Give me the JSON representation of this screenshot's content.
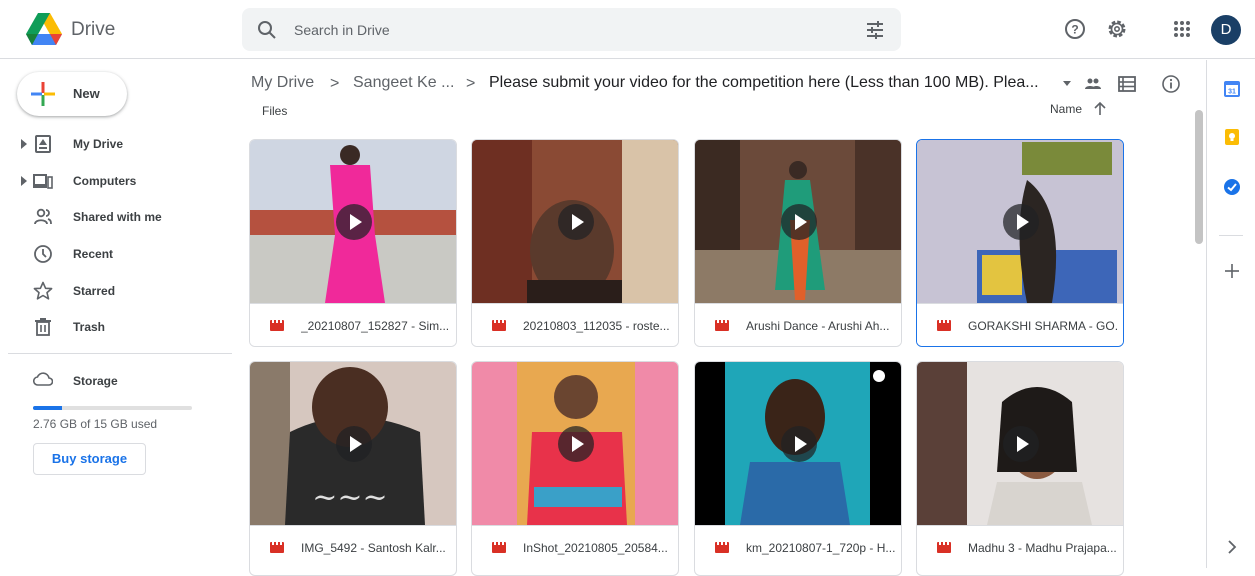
{
  "header": {
    "product_name": "Drive",
    "search_placeholder": "Search in Drive",
    "avatar_letter": "D"
  },
  "sidebar": {
    "new_label": "New",
    "items": [
      {
        "label": "My Drive",
        "icon": "my-drive-icon",
        "expandable": true
      },
      {
        "label": "Computers",
        "icon": "computers-icon",
        "expandable": true
      },
      {
        "label": "Shared with me",
        "icon": "shared-with-me-icon",
        "expandable": false
      },
      {
        "label": "Recent",
        "icon": "clock-icon",
        "expandable": false
      },
      {
        "label": "Starred",
        "icon": "star-icon",
        "expandable": false
      },
      {
        "label": "Trash",
        "icon": "trash-icon",
        "expandable": false
      }
    ],
    "storage_label": "Storage",
    "storage_used_fraction": 0.184,
    "storage_text": "2.76 GB of 15 GB used",
    "buy_storage_label": "Buy storage"
  },
  "breadcrumb": {
    "items": [
      "My Drive",
      "Sangeet Ke ...",
      "Please submit your video for the competition here (Less than 100 MB). Plea..."
    ]
  },
  "main": {
    "section_label": "Files",
    "sort_label": "Name"
  },
  "files": [
    {
      "name": "_20210807_152827 - Sim...",
      "selected": false
    },
    {
      "name": "20210803_112035 - roste...",
      "selected": false
    },
    {
      "name": "Arushi Dance - Arushi Ah...",
      "selected": false
    },
    {
      "name": "GORAKSHI SHARMA - GO...",
      "selected": true
    },
    {
      "name": "IMG_5492 - Santosh Kalr...",
      "selected": false
    },
    {
      "name": "InShot_20210805_20584...",
      "selected": false
    },
    {
      "name": "km_20210807-1_720p - H...",
      "selected": false
    },
    {
      "name": "Madhu 3 - Madhu Prajapa...",
      "selected": false
    }
  ],
  "colors": {
    "accent": "#1a73e8",
    "video_icon": "#d93025"
  }
}
